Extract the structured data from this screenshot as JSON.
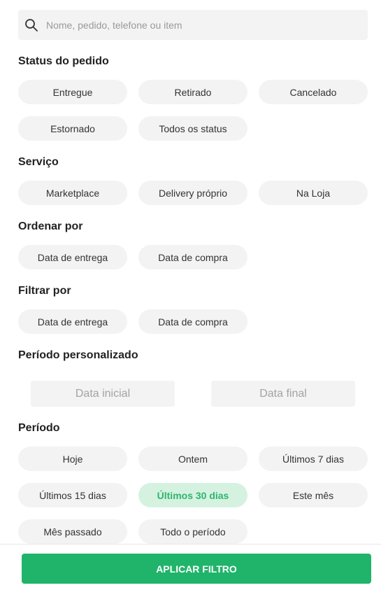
{
  "search": {
    "placeholder": "Nome, pedido, telefone ou item",
    "value": ""
  },
  "sections": {
    "status": {
      "title": "Status do pedido",
      "chips": [
        "Entregue",
        "Retirado",
        "Cancelado",
        "Estornado",
        "Todos os status"
      ]
    },
    "servico": {
      "title": "Serviço",
      "chips": [
        "Marketplace",
        "Delivery próprio",
        "Na Loja"
      ]
    },
    "ordenar": {
      "title": "Ordenar por",
      "chips": [
        "Data de entrega",
        "Data de compra"
      ]
    },
    "filtrar": {
      "title": "Filtrar por",
      "chips": [
        "Data de entrega",
        "Data de compra"
      ]
    },
    "periodo_personalizado": {
      "title": "Período personalizado",
      "start_placeholder": "Data inicial",
      "end_placeholder": "Data final"
    },
    "periodo": {
      "title": "Período",
      "chips": [
        "Hoje",
        "Ontem",
        "Últimos 7 dias",
        "Últimos 15 dias",
        "Últimos 30 dias",
        "Este mês",
        "Mês passado",
        "Todo o período"
      ],
      "selected": "Últimos 30 dias"
    }
  },
  "footer": {
    "apply_label": "APLICAR FILTRO"
  },
  "colors": {
    "accent": "#1fb46a",
    "chip_bg": "#f3f3f3",
    "selected_bg": "#d5f2e1",
    "selected_text": "#2fb56c"
  },
  "icons": {
    "search": "search-icon"
  }
}
